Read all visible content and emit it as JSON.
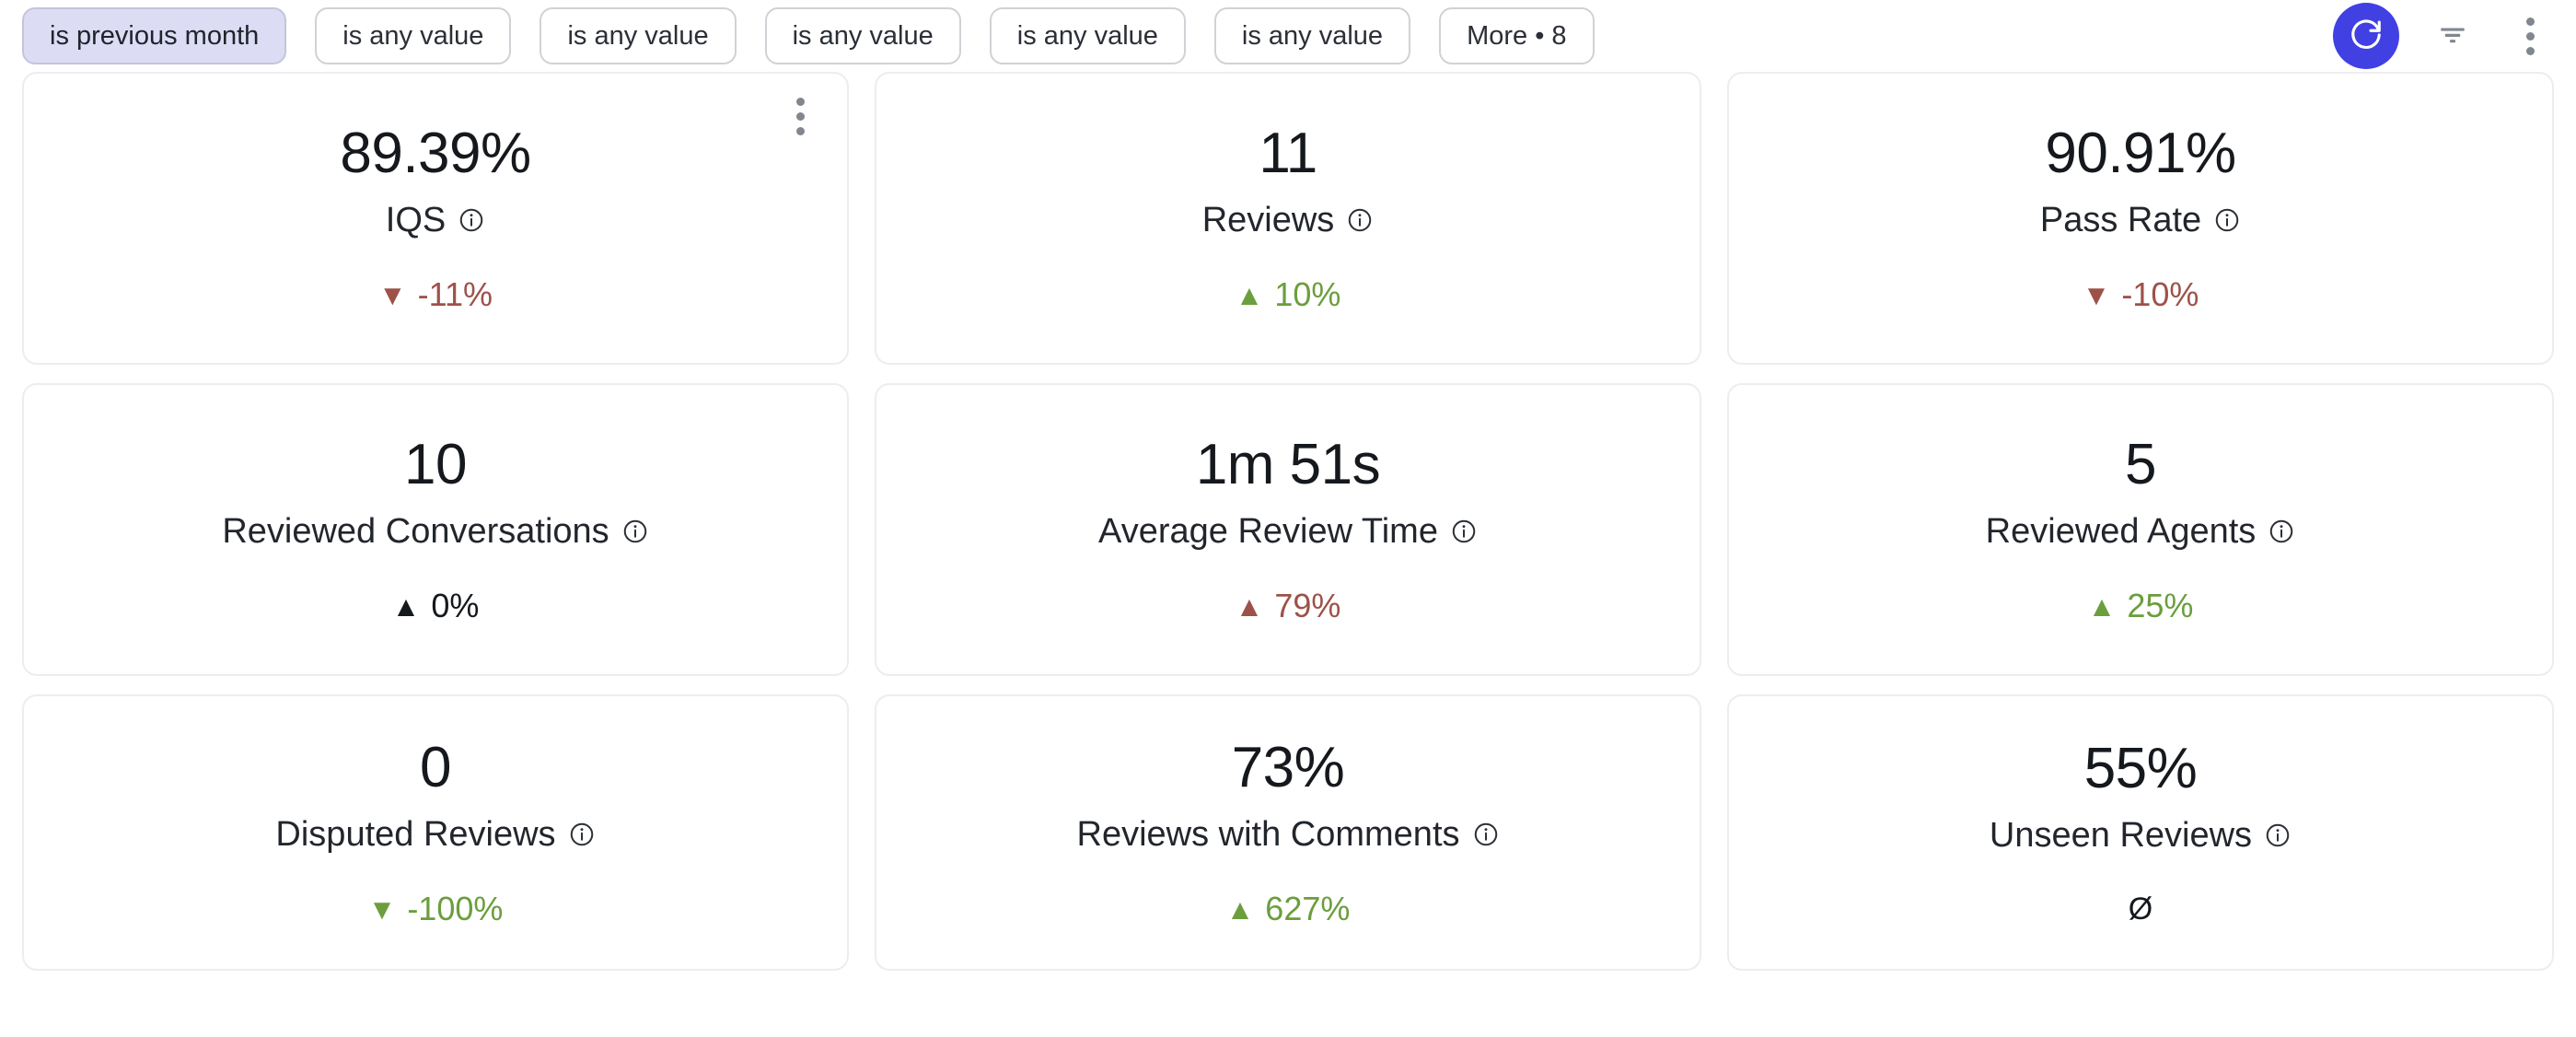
{
  "filter_bar": {
    "chips": [
      {
        "label": "is previous month",
        "active": true
      },
      {
        "label": "is any value",
        "active": false
      },
      {
        "label": "is any value",
        "active": false
      },
      {
        "label": "is any value",
        "active": false
      },
      {
        "label": "is any value",
        "active": false
      },
      {
        "label": "is any value",
        "active": false
      }
    ],
    "more_label": "More • 8",
    "actions": {
      "refresh_icon": "refresh-icon",
      "filter_icon": "filter-icon",
      "overflow_icon": "kebab-menu-icon"
    },
    "colors": {
      "refresh_button_bg": "#4140e3",
      "active_chip_bg": "#dcdcf5",
      "chip_border": "#cfd2d6"
    }
  },
  "colors": {
    "positive": "#6b9e3d",
    "negative": "#9d5249",
    "neutral": "#15181d",
    "card_border": "#ecedf1"
  },
  "cards": [
    {
      "value": "89.39%",
      "label": "IQS",
      "info_icon": "info-icon",
      "delta_arrow": "▼",
      "delta_text": "-11%",
      "delta_tone": "down",
      "has_menu": true,
      "menu_icon": "kebab-menu-icon"
    },
    {
      "value": "11",
      "label": "Reviews",
      "info_icon": "info-icon",
      "delta_arrow": "▲",
      "delta_text": "10%",
      "delta_tone": "up",
      "has_menu": false
    },
    {
      "value": "90.91%",
      "label": "Pass Rate",
      "info_icon": "info-icon",
      "delta_arrow": "▼",
      "delta_text": "-10%",
      "delta_tone": "down",
      "has_menu": false
    },
    {
      "value": "10",
      "label": "Reviewed Conversations",
      "info_icon": "info-icon",
      "delta_arrow": "▲",
      "delta_text": "0%",
      "delta_tone": "flat",
      "has_menu": false
    },
    {
      "value": "1m 51s",
      "label": "Average Review Time",
      "info_icon": "info-icon",
      "delta_arrow": "▲",
      "delta_text": "79%",
      "delta_tone": "down",
      "has_menu": false
    },
    {
      "value": "5",
      "label": "Reviewed Agents",
      "info_icon": "info-icon",
      "delta_arrow": "▲",
      "delta_text": "25%",
      "delta_tone": "up",
      "has_menu": false
    },
    {
      "value": "0",
      "label": "Disputed Reviews",
      "info_icon": "info-icon",
      "delta_arrow": "▼",
      "delta_text": "-100%",
      "delta_tone": "up",
      "has_menu": false
    },
    {
      "value": "73%",
      "label": "Reviews with Comments",
      "info_icon": "info-icon",
      "delta_arrow": "▲",
      "delta_text": "627%",
      "delta_tone": "up",
      "has_menu": false
    },
    {
      "value": "55%",
      "label": "Unseen Reviews",
      "info_icon": "info-icon",
      "delta_arrow": "",
      "delta_text": "Ø",
      "delta_tone": "none",
      "has_menu": false
    }
  ]
}
